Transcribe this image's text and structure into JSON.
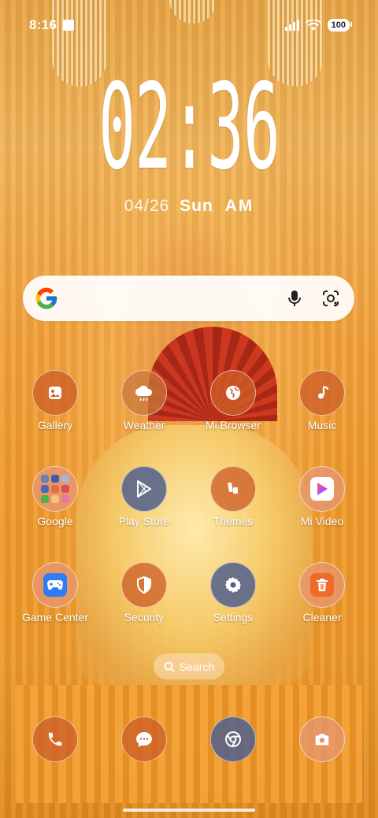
{
  "status_bar": {
    "time": "8:16",
    "battery": "100"
  },
  "clock": {
    "time": "02:36",
    "date": "04/26",
    "weekday": "Sun",
    "ampm": "AM"
  },
  "search_bar": {
    "logo": "google-g-icon",
    "mic": "mic-icon",
    "lens": "google-lens-icon"
  },
  "apps": {
    "gallery": "Gallery",
    "weather": "Weather",
    "mi_browser": "Mi Browser",
    "music": "Music",
    "google": "Google",
    "play_store": "Play Store",
    "themes": "Themes",
    "mi_video": "Mi Video",
    "game_center": "Game Center",
    "security": "Security",
    "settings": "Settings",
    "cleaner": "Cleaner"
  },
  "app_search": {
    "label": "Search"
  },
  "dock": [
    "phone-icon",
    "messages-icon",
    "chrome-icon",
    "camera-icon"
  ],
  "colors": {
    "accent_blue": "#4f5f8c",
    "accent_orange": "#cd5f28"
  }
}
